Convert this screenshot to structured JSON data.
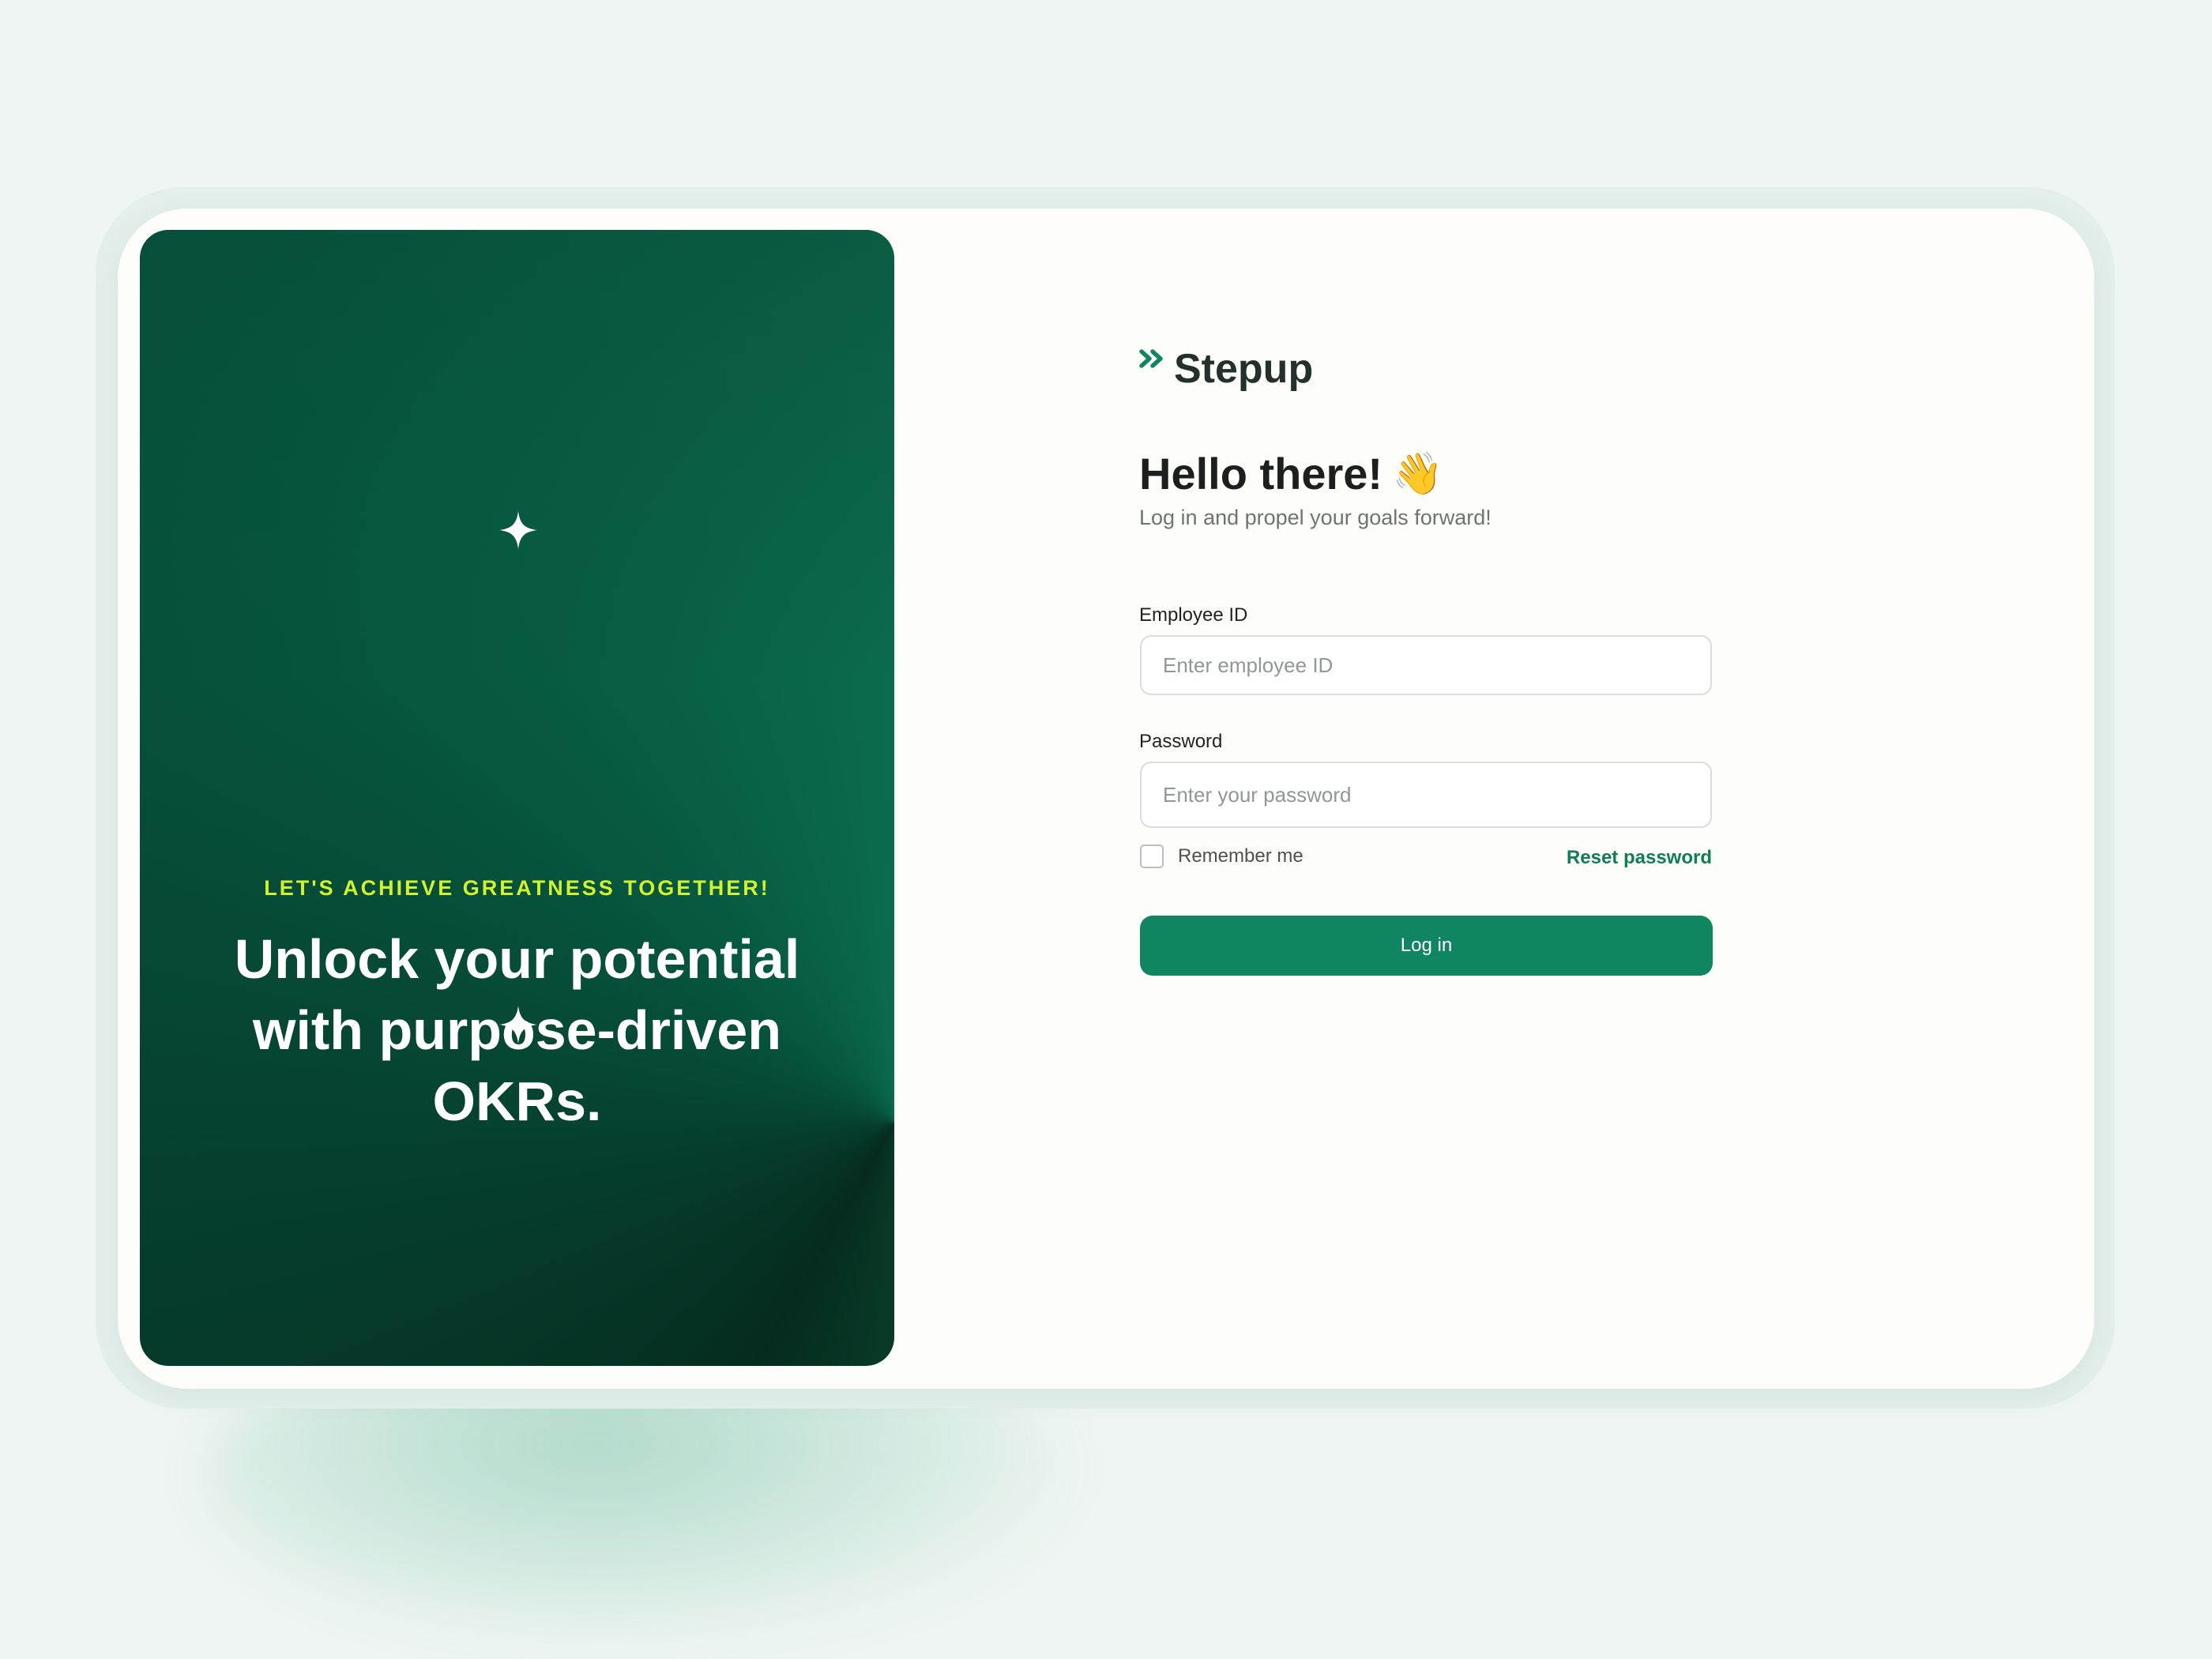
{
  "brand": {
    "name": "Stepup",
    "mark_icon": "double-chevron-right-icon",
    "accent": "#108562"
  },
  "hero": {
    "eyebrow": "LET'S ACHIEVE GREATNESS TOGETHER!",
    "title": "Unlock your potential with purpose-driven OKRs.",
    "eyebrow_color": "#d3f22c",
    "icons": [
      "sparkle-icon",
      "sparkle-icon"
    ]
  },
  "login": {
    "greeting": "Hello there!",
    "greeting_emoji": "👋",
    "subtitle": "Log in and propel your goals forward!",
    "employee_id": {
      "label": "Employee ID",
      "placeholder": "Enter employee ID",
      "value": ""
    },
    "password": {
      "label": "Password",
      "placeholder": "Enter your password",
      "value": ""
    },
    "remember_me": {
      "label": "Remember me",
      "checked": false
    },
    "reset_password": "Reset password",
    "submit_label": "Log in"
  }
}
